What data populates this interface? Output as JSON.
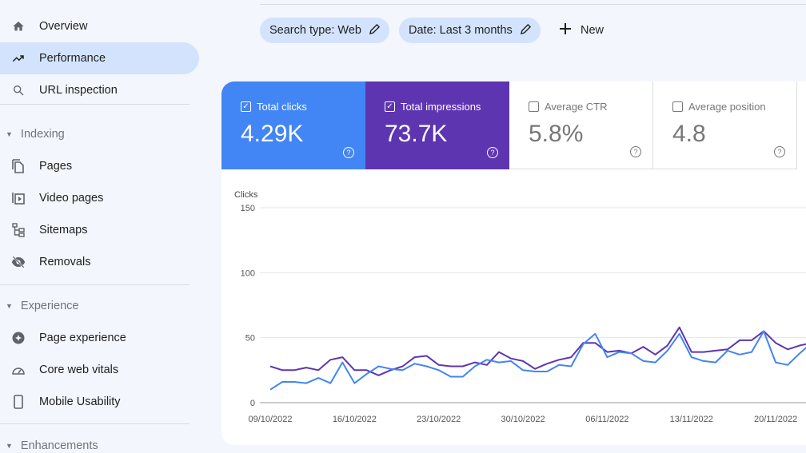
{
  "sidebar": {
    "items": [
      {
        "label": "Overview",
        "icon": "home-icon"
      },
      {
        "label": "Performance",
        "icon": "trending-up-icon",
        "active": true
      },
      {
        "label": "URL inspection",
        "icon": "search-icon"
      }
    ],
    "indexing": {
      "title": "Indexing",
      "items": [
        {
          "label": "Pages",
          "icon": "pages-icon"
        },
        {
          "label": "Video pages",
          "icon": "video-pages-icon"
        },
        {
          "label": "Sitemaps",
          "icon": "sitemap-icon"
        },
        {
          "label": "Removals",
          "icon": "eye-off-icon"
        }
      ]
    },
    "experience": {
      "title": "Experience",
      "items": [
        {
          "label": "Page experience",
          "icon": "page-experience-icon"
        },
        {
          "label": "Core web vitals",
          "icon": "gauge-icon"
        },
        {
          "label": "Mobile Usability",
          "icon": "phone-icon"
        }
      ]
    },
    "enhancements": {
      "title": "Enhancements"
    }
  },
  "filters": {
    "search_type": "Search type: Web",
    "date": "Date: Last 3 months",
    "new_label": "New"
  },
  "metrics": [
    {
      "label": "Total clicks",
      "value": "4.29K",
      "checked": true,
      "color": "#4285f4"
    },
    {
      "label": "Total impressions",
      "value": "73.7K",
      "checked": true,
      "color": "#5e35b1"
    },
    {
      "label": "Average CTR",
      "value": "5.8%",
      "checked": false
    },
    {
      "label": "Average position",
      "value": "4.8",
      "checked": false
    }
  ],
  "chart_data": {
    "type": "line",
    "ylabel": "Clicks",
    "ylim": [
      0,
      150
    ],
    "yticks": [
      "150",
      "100",
      "50",
      "0"
    ],
    "xticks": [
      "09/10/2022",
      "16/10/2022",
      "23/10/2022",
      "30/10/2022",
      "06/11/2022",
      "13/11/2022",
      "20/11/2022"
    ],
    "x_start": "09/10/2022",
    "grid": true,
    "series": [
      {
        "name": "Total clicks",
        "color": "#4285f4",
        "values": [
          10,
          16,
          16,
          15,
          19,
          15,
          31,
          15,
          22,
          28,
          26,
          25,
          30,
          28,
          25,
          20,
          20,
          28,
          33,
          31,
          32,
          25,
          24,
          24,
          29,
          28,
          45,
          53,
          35,
          39,
          38,
          32,
          31,
          40,
          53,
          35,
          32,
          31,
          40,
          37,
          39,
          55,
          31,
          29,
          38,
          46
        ]
      },
      {
        "name": "Total impressions",
        "color": "#5e35b1",
        "values": [
          28,
          25,
          25,
          27,
          25,
          33,
          35,
          25,
          25,
          21,
          25,
          28,
          35,
          36,
          29,
          28,
          28,
          31,
          29,
          39,
          34,
          32,
          26,
          30,
          33,
          35,
          46,
          46,
          39,
          40,
          38,
          43,
          37,
          44,
          58,
          39,
          39,
          40,
          41,
          48,
          48,
          55,
          46,
          41,
          44,
          46
        ]
      }
    ]
  }
}
